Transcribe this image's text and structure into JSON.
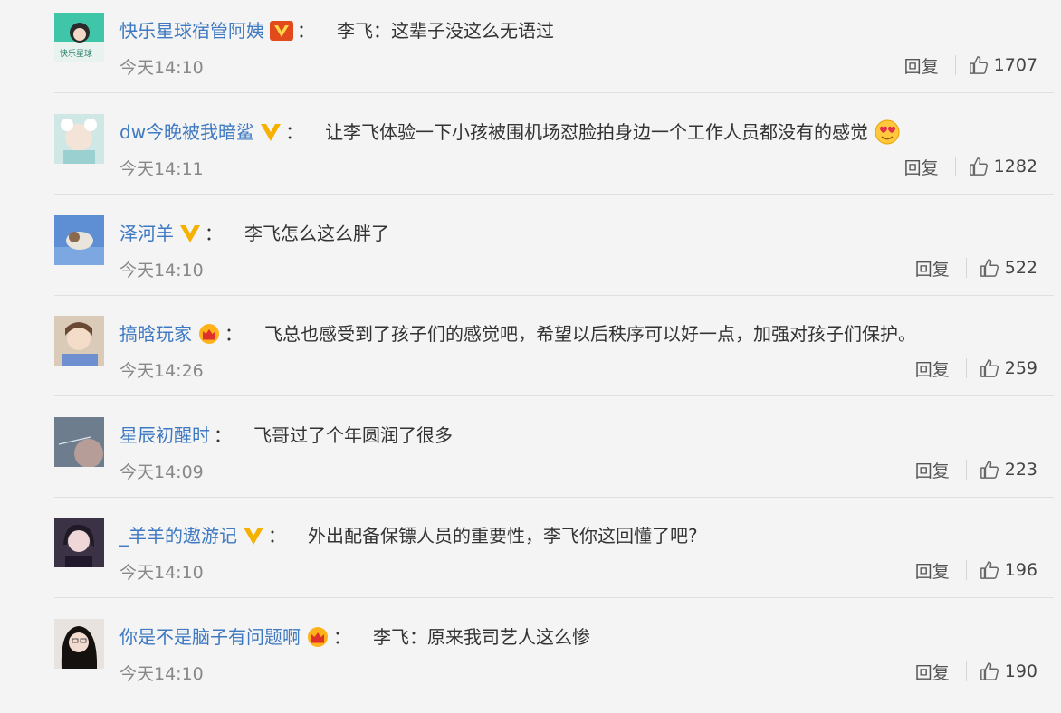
{
  "comments": [
    {
      "username": "快乐星球宿管阿姨",
      "badge": "vip-v-red-icon",
      "text": "李飞：这辈子没这么无语过",
      "emoji": "",
      "time": "今天14:10",
      "reply": "回复",
      "likes": "1707"
    },
    {
      "username": "dw今晚被我暗鲨",
      "badge": "vip-v-gold-icon",
      "text": "让李飞体验一下小孩被围机场怼脸拍身边一个工作人员都没有的感觉",
      "emoji": "love-face-emoji",
      "time": "今天14:11",
      "reply": "回复",
      "likes": "1282"
    },
    {
      "username": "泽河羊",
      "badge": "vip-v-gold-icon",
      "text": "李飞怎么这么胖了",
      "emoji": "",
      "time": "今天14:10",
      "reply": "回复",
      "likes": "522"
    },
    {
      "username": "搞晗玩家",
      "badge": "crown-icon",
      "text": "飞总也感受到了孩子们的感觉吧，希望以后秩序可以好一点，加强对孩子们保护。",
      "emoji": "",
      "time": "今天14:26",
      "reply": "回复",
      "likes": "259"
    },
    {
      "username": "星辰初醒时",
      "badge": "",
      "text": "飞哥过了个年圆润了很多",
      "emoji": "",
      "time": "今天14:09",
      "reply": "回复",
      "likes": "223"
    },
    {
      "username": "_羊羊的遨游记",
      "badge": "vip-v-gold-icon",
      "text": "外出配备保镖人员的重要性，李飞你这回懂了吧?",
      "emoji": "",
      "time": "今天14:10",
      "reply": "回复",
      "likes": "196"
    },
    {
      "username": "你是不是脑子有问题啊",
      "badge": "crown-icon",
      "text": "李飞：原来我司艺人这么惨",
      "emoji": "",
      "time": "今天14:10",
      "reply": "回复",
      "likes": "190"
    }
  ],
  "colon": "：",
  "colors": {
    "username": "#3e79c2",
    "text": "#333333",
    "muted": "#888888",
    "background": "#f4f4f4"
  }
}
